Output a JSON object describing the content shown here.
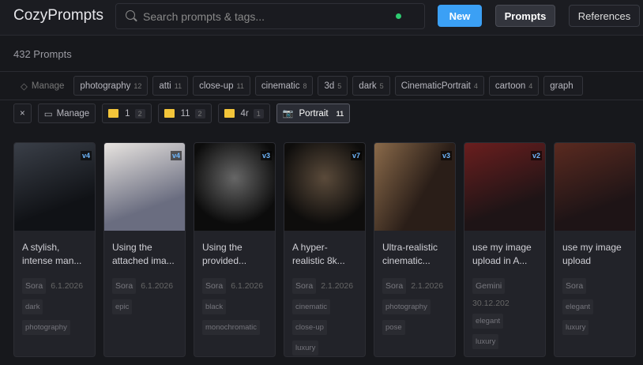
{
  "header": {
    "logo": "CozyPrompts",
    "search_placeholder": "Search prompts & tags...",
    "status_color": "#2ecc71",
    "new_label": "New",
    "prompts_label": "Prompts",
    "references_label": "References"
  },
  "count": "432 Prompts",
  "tags_bar": {
    "manage": "Manage",
    "tags": [
      {
        "label": "photography",
        "n": "12"
      },
      {
        "label": "atti",
        "n": "11"
      },
      {
        "label": "close-up",
        "n": "11"
      },
      {
        "label": "cinematic",
        "n": "8"
      },
      {
        "label": "3d",
        "n": "5"
      },
      {
        "label": "dark",
        "n": "5"
      },
      {
        "label": "CinematicPortrait",
        "n": "4"
      },
      {
        "label": "cartoon",
        "n": "4"
      },
      {
        "label": "graph",
        "n": ""
      }
    ]
  },
  "folders_bar": {
    "close": "×",
    "manage": "Manage",
    "folders": [
      {
        "label": "1",
        "n": "2"
      },
      {
        "label": "11",
        "n": "2"
      },
      {
        "label": "4r",
        "n": "1"
      }
    ],
    "active": {
      "label": "Portrait",
      "n": "11"
    }
  },
  "accent": "#3ba0f5",
  "cards": [
    {
      "version": "v4",
      "title": "A stylish, intense man...",
      "source": "Sora",
      "date": "6.1.2026",
      "tags": [
        "dark",
        "photography"
      ]
    },
    {
      "version": "v4",
      "title": "Using the attached ima...",
      "source": "Sora",
      "date": "6.1.2026",
      "tags": [
        "epic"
      ]
    },
    {
      "version": "v3",
      "title": "Using the provided...",
      "source": "Sora",
      "date": "6.1.2026",
      "tags": [
        "black",
        "monochromatic"
      ]
    },
    {
      "version": "v7",
      "title": "A hyper-realistic 8k...",
      "source": "Sora",
      "date": "2.1.2026",
      "tags": [
        "cinematic",
        "close-up",
        "luxury"
      ]
    },
    {
      "version": "v3",
      "title": "Ultra-realistic cinematic...",
      "source": "Sora",
      "date": "2.1.2026",
      "tags": [
        "photography",
        "pose"
      ]
    },
    {
      "version": "v2",
      "title": "use my image upload in A...",
      "source": "Gemini",
      "date": "30.12.202",
      "tags": [
        "elegant",
        "luxury"
      ]
    },
    {
      "version": "",
      "title": "use my image upload",
      "source": "Sora",
      "date": "",
      "tags": [
        "elegant",
        "luxury"
      ]
    }
  ]
}
